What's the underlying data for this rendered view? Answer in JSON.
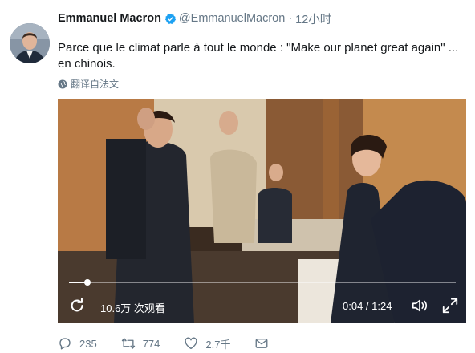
{
  "tweet": {
    "display_name": "Emmanuel Macron",
    "handle": "@EmmanuelMacron",
    "separator": "·",
    "timestamp": "12小时",
    "verified_icon": "verified-badge-icon",
    "text": "Parce que le climat parle à tout le monde : \"Make our planet great again\" ... en chinois.",
    "translate_label": "翻译自法文",
    "accent_color": "#1da1f2"
  },
  "video": {
    "views": "10.6万 次观看",
    "time_display": "0:04 / 1:24",
    "progress": 0.048,
    "icons": [
      "replay-icon",
      "volume-icon",
      "fullscreen-icon"
    ]
  },
  "actions": {
    "reply_count": "235",
    "retweet_count": "774",
    "like_count": "2.7千",
    "icons": [
      "reply-icon",
      "retweet-icon",
      "like-icon",
      "message-icon"
    ]
  }
}
